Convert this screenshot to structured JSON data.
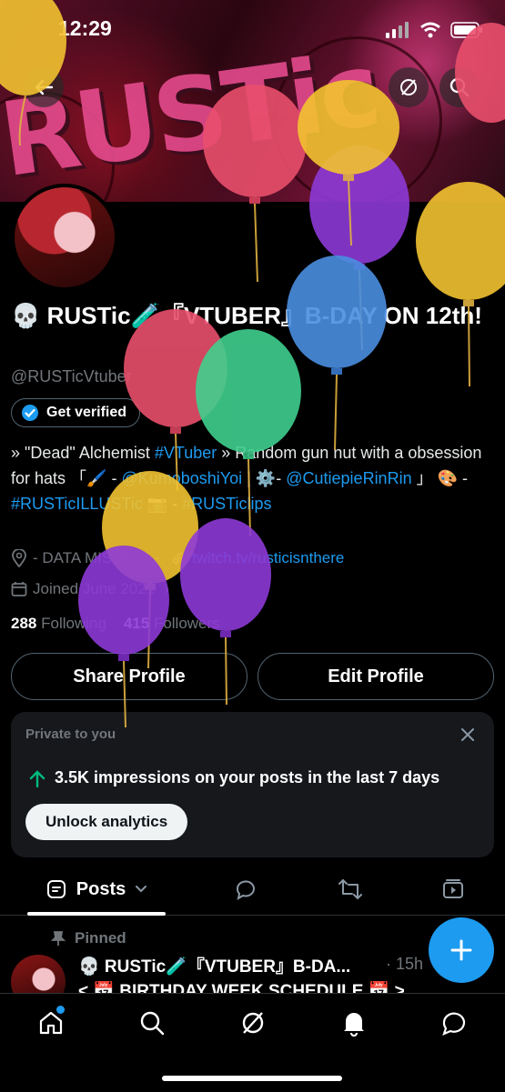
{
  "status_bar": {
    "time": "12:29"
  },
  "banner": {
    "art_text": "RUSTic"
  },
  "profile": {
    "display_name": "💀 RUSTic🧪『VTUBER』B-DAY ON 12th!",
    "handle": "@RUSTicVtuber",
    "verify_label": "Get verified",
    "bio_part1": "» \"Dead\" Alchemist ",
    "bio_tag_vtuber": "#VTuber",
    "bio_part2": " » Random gun nut with a obsession for hats 「🖌️ - ",
    "bio_mention1": "@KumoboshiYoi",
    "bio_part3": " | ⚙️- ",
    "bio_mention2": "@CutiepieRinRin",
    "bio_part4": " 」 🎨 - ",
    "bio_tag_illustic": "#RUSTicILLUSTic",
    "bio_part5": " 📷 - ",
    "bio_tag_clips": "#RUSTiclips",
    "location": "- DATA MISSING -",
    "website": "twitch.tv/rusticisnthere",
    "joined": "Joined June 2021",
    "following_count": "288",
    "following_label": "Following",
    "followers_count": "415",
    "followers_label": "Followers"
  },
  "buttons": {
    "share": "Share Profile",
    "edit": "Edit Profile"
  },
  "analytics_card": {
    "title": "Private to you",
    "stat_text": "3.5K impressions on your posts in the last 7 days",
    "unlock_label": "Unlock analytics"
  },
  "tabs": {
    "posts_label": "Posts"
  },
  "pinned_post": {
    "pinned_label": "Pinned",
    "author": "💀 RUSTic🧪『VTUBER』B-DA...",
    "time": "· 15h",
    "preview": "< 📅 BIRTHDAY WEEK SCHEDULE 📅 >"
  },
  "colors": {
    "accent_blue": "#1d9bf0",
    "verified_blue": "#1d9bf0",
    "background": "#000000",
    "card": "#16181c",
    "growth_green": "#00ba7c"
  },
  "icons": {
    "back": "arrow-left-icon",
    "grok": "grok-icon",
    "search": "search-icon",
    "verified": "verified-badge-icon",
    "location": "location-pin-icon",
    "link": "link-icon",
    "calendar": "calendar-icon",
    "close": "close-icon",
    "growth": "arrow-up-icon",
    "compose": "plus-icon"
  }
}
